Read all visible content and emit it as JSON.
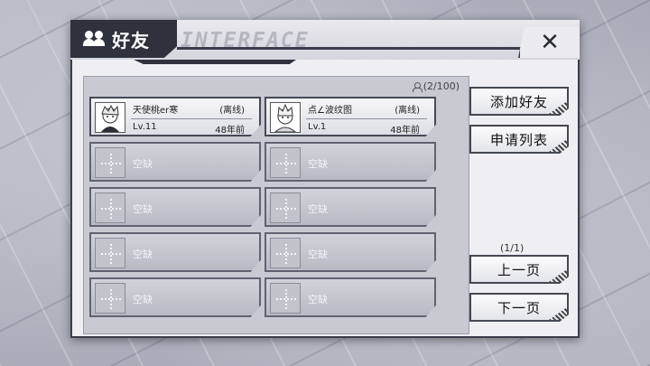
{
  "window": {
    "title": "好友",
    "watermark": "INTERFACE",
    "close_label": "✕"
  },
  "friends": {
    "count": "(2/100)",
    "slots": [
      {
        "name": "天使桃er寒",
        "status": "(离线)",
        "level": "Lv.11",
        "last_online": "48年前"
      },
      {
        "name": "点∠波纹图",
        "status": "(离线)",
        "level": "Lv.1",
        "last_online": "48年前"
      },
      {
        "empty_label": "空缺"
      },
      {
        "empty_label": "空缺"
      },
      {
        "empty_label": "空缺"
      },
      {
        "empty_label": "空缺"
      },
      {
        "empty_label": "空缺"
      },
      {
        "empty_label": "空缺"
      },
      {
        "empty_label": "空缺"
      },
      {
        "empty_label": "空缺"
      }
    ]
  },
  "actions": {
    "add_friend": "添加好友",
    "request_list": "申请列表",
    "page_indicator": "(1/1)",
    "prev_page": "上一页",
    "next_page": "下一页"
  },
  "colors": {
    "accent_dark": "#2f323d",
    "panel_bg": "#c8c9d1",
    "window_bg": "#efeff3"
  }
}
